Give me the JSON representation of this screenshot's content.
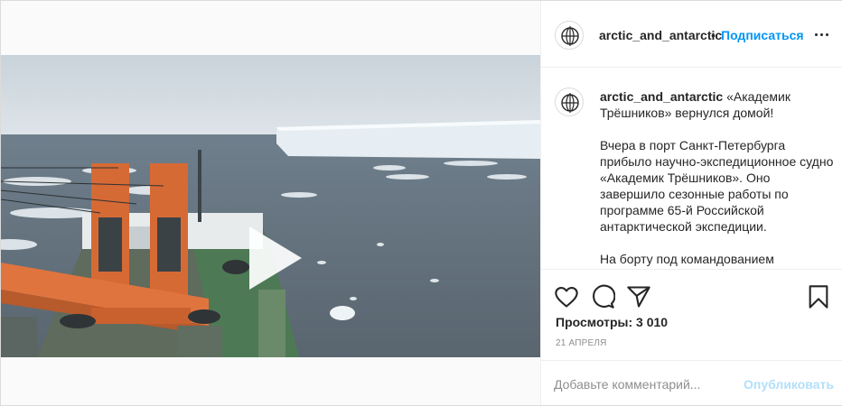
{
  "post": {
    "username": "arctic_and_antarctic",
    "header_username": "arctic_and_antarctic",
    "separator": "•",
    "follow_label": "Подписаться",
    "caption": {
      "username": "arctic_and_antarctic",
      "title": "«Академик Трёшников» вернулся домой!",
      "paragraph_1": "Вчера в порт Санкт-Петербурга прибыло научно-экспедиционное судно «Академик Трёшников». Оно завершило сезонные работы по программе 65-й Российской антарктической экспедиции.",
      "paragraph_2": "На борту под командованием"
    },
    "views_label": "Просмотры: 3 010",
    "date": "21 апреля",
    "comment": {
      "placeholder": "Добавьте комментарий...",
      "publish_label": "Опубликовать"
    },
    "icons": {
      "more": "more-options-icon",
      "like": "heart-icon",
      "comment": "comment-bubble-icon",
      "share": "paper-plane-icon",
      "save": "bookmark-icon",
      "play": "play-icon",
      "avatar": "globe-logo-icon"
    },
    "colors": {
      "link_blue": "#0095f6",
      "publish_disabled": "#b2dffc",
      "muted": "#8e8e8e",
      "text": "#262626"
    }
  }
}
